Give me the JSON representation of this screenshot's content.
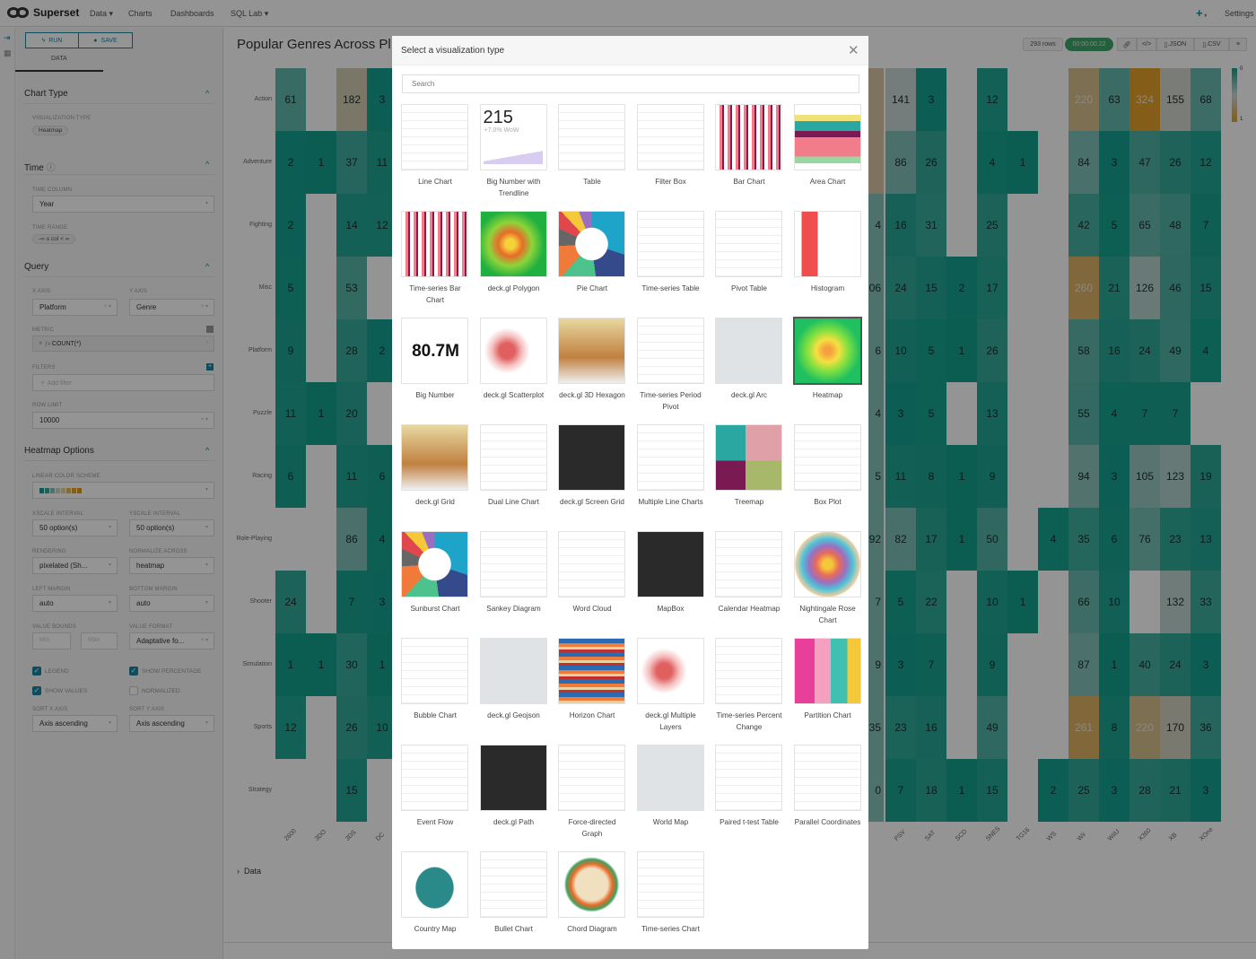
{
  "nav": {
    "brand": "Superset",
    "items": [
      "Data",
      "Charts",
      "Dashboards",
      "SQL Lab"
    ],
    "dropdown_items": [
      true,
      false,
      false,
      true
    ],
    "plus": "+",
    "settings": "Settings"
  },
  "panel": {
    "run": "RUN",
    "save": "SAVE",
    "tab": "DATA",
    "chart_type": {
      "title": "Chart Type",
      "viz_label": "VISUALIZATION TYPE",
      "viz_value": "Heatmap"
    },
    "time": {
      "title": "Time",
      "column_label": "TIME COLUMN",
      "column_value": "Year",
      "range_label": "TIME RANGE",
      "range_value": "-∞ ≤ col < ∞"
    },
    "query": {
      "title": "Query",
      "x_label": "X AXIS",
      "x_value": "Platform",
      "y_label": "Y AXIS",
      "y_value": "Genre",
      "metric_label": "METRIC",
      "metric_value": "COUNT(*)",
      "filters_label": "FILTERS",
      "filters_placeholder": "Add filter",
      "row_limit_label": "ROW LIMIT",
      "row_limit_value": "10000"
    },
    "heatmap": {
      "title": "Heatmap Options",
      "scheme_label": "LINEAR COLOR SCHEME",
      "scheme_colors": [
        "#1a9e8f",
        "#3aa89a",
        "#8fc3bb",
        "#cfd8d5",
        "#e8d2a0",
        "#e6b75a",
        "#e0a52a",
        "#d99a1a"
      ],
      "xscale_label": "XSCALE INTERVAL",
      "xscale_value": "50 option(s)",
      "yscale_label": "YSCALE INTERVAL",
      "yscale_value": "50 option(s)",
      "rendering_label": "RENDERING",
      "rendering_value": "pixelated (Sh...",
      "normalize_label": "NORMALIZE ACROSS",
      "normalize_value": "heatmap",
      "left_margin_label": "LEFT MARGIN",
      "left_margin_value": "auto",
      "bottom_margin_label": "BOTTOM MARGIN",
      "bottom_margin_value": "auto",
      "bounds_label": "VALUE BOUNDS",
      "min_placeholder": "Min",
      "max_placeholder": "Max",
      "format_label": "VALUE FORMAT",
      "format_value": "Adaptative fo...",
      "legend": {
        "label": "LEGEND",
        "checked": true
      },
      "show_pct": {
        "label": "SHOW PERCENTAGE",
        "checked": true
      },
      "show_values": {
        "label": "SHOW VALUES",
        "checked": true
      },
      "normalized": {
        "label": "NORMALIZED",
        "checked": false
      },
      "sort_x_label": "SORT X AXIS",
      "sort_x_value": "Axis ascending",
      "sort_y_label": "SORT Y AXIS",
      "sort_y_value": "Axis ascending"
    }
  },
  "chart": {
    "title": "Popular Genres Across Pl",
    "rows": "293 rows",
    "timer": "00:00:00.22",
    "json": ".JSON",
    "csv": ".CSV",
    "data_section": "Data",
    "legend_min": "0",
    "legend_max": "1"
  },
  "chart_data": {
    "type": "heatmap",
    "y": [
      "Action",
      "Adventure",
      "Fighting",
      "Misc",
      "Platform",
      "Puzzle",
      "Racing",
      "Role-Playing",
      "Shooter",
      "Simulation",
      "Sports",
      "Strategy"
    ],
    "x_left": [
      "2600",
      "3DO",
      "3DS",
      "DC"
    ],
    "values_left": [
      [
        61,
        null,
        182,
        3
      ],
      [
        2,
        1,
        37,
        11
      ],
      [
        2,
        null,
        14,
        12
      ],
      [
        5,
        null,
        53,
        null
      ],
      [
        9,
        null,
        28,
        2
      ],
      [
        11,
        1,
        20,
        null
      ],
      [
        6,
        null,
        11,
        6
      ],
      [
        null,
        null,
        86,
        4
      ],
      [
        24,
        null,
        7,
        3
      ],
      [
        1,
        1,
        30,
        1
      ],
      [
        12,
        null,
        26,
        10
      ],
      [
        null,
        null,
        15,
        null
      ]
    ],
    "x_right_partial_label": "P",
    "partial_column_text": [
      "",
      "",
      "4",
      "06",
      "6",
      "4",
      "5",
      "92",
      "7",
      "9",
      "35",
      "0"
    ],
    "x_right": [
      "PSV",
      "SAT",
      "SCD",
      "SNES",
      "TG16",
      "WS",
      "Wii",
      "WiiU",
      "X360",
      "XB",
      "XOne"
    ],
    "values_right": [
      [
        141,
        3,
        null,
        12,
        null,
        null,
        220,
        63,
        324,
        155,
        68
      ],
      [
        86,
        26,
        null,
        4,
        1,
        null,
        84,
        3,
        47,
        26,
        12
      ],
      [
        16,
        31,
        null,
        25,
        null,
        null,
        42,
        5,
        65,
        48,
        7
      ],
      [
        24,
        15,
        2,
        17,
        null,
        null,
        260,
        21,
        126,
        46,
        15
      ],
      [
        10,
        5,
        1,
        26,
        null,
        null,
        58,
        16,
        24,
        49,
        4
      ],
      [
        3,
        5,
        null,
        13,
        null,
        null,
        55,
        4,
        7,
        7,
        null
      ],
      [
        11,
        8,
        1,
        9,
        null,
        null,
        94,
        3,
        105,
        123,
        19
      ],
      [
        82,
        17,
        1,
        50,
        null,
        4,
        35,
        6,
        76,
        23,
        13
      ],
      [
        5,
        22,
        null,
        10,
        1,
        null,
        66,
        10,
        null,
        132,
        33
      ],
      [
        3,
        7,
        null,
        9,
        null,
        null,
        87,
        1,
        40,
        24,
        3
      ],
      [
        23,
        16,
        null,
        49,
        null,
        null,
        261,
        8,
        220,
        170,
        36
      ],
      [
        7,
        18,
        1,
        15,
        null,
        2,
        25,
        3,
        28,
        21,
        3
      ]
    ],
    "color_scale": {
      "min_color": "#12a08e",
      "mid_color": "#cfd9d6",
      "max_color": "#e3a02a"
    },
    "legend": "top-right"
  },
  "modal": {
    "title": "Select a visualization type",
    "search_placeholder": "Search",
    "selected": "Heatmap",
    "big_number_trend": {
      "value": "215",
      "delta": "+7.0% WoW"
    },
    "big_number": {
      "value": "80.7M"
    },
    "types": [
      "Line Chart",
      "Big Number with Trendline",
      "Table",
      "Filter Box",
      "Bar Chart",
      "Area Chart",
      "Time-series Bar Chart",
      "deck.gl Polygon",
      "Pie Chart",
      "Time-series Table",
      "Pivot Table",
      "Histogram",
      "Big Number",
      "deck.gl Scatterplot",
      "deck.gl 3D Hexagon",
      "Time-series Period Pivot",
      "deck.gl Arc",
      "Heatmap",
      "deck.gl Grid",
      "Dual Line Chart",
      "deck.gl Screen Grid",
      "Multiple Line Charts",
      "Treemap",
      "Box Plot",
      "Sunburst Chart",
      "Sankey Diagram",
      "Word Cloud",
      "MapBox",
      "Calendar Heatmap",
      "Nightingale Rose Chart",
      "Bubble Chart",
      "deck.gl Geojson",
      "Horizon Chart",
      "deck.gl Multiple Layers",
      "Time-series Percent Change",
      "Partition Chart",
      "Event Flow",
      "deck.gl Path",
      "Force-directed Graph",
      "World Map",
      "Paired t-test Table",
      "Parallel Coordinates",
      "Country Map",
      "Bullet Chart",
      "Chord Diagram",
      "Time-series Chart"
    ]
  }
}
